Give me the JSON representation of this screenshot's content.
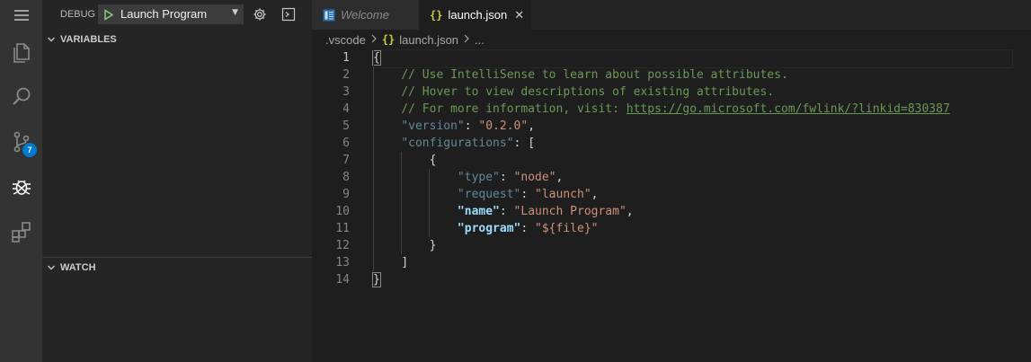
{
  "activity": {
    "badge_count": "7"
  },
  "sidebar": {
    "debug_label": "DEBUG",
    "config_name": "Launch Program",
    "variables_title": "VARIABLES",
    "watch_title": "WATCH"
  },
  "tabs": [
    {
      "label": "Welcome"
    },
    {
      "label": "launch.json",
      "close": "✕"
    }
  ],
  "breadcrumb": {
    "folder": ".vscode",
    "file": "launch.json",
    "more": "..."
  },
  "editor": {
    "line_numbers": [
      "1",
      "2",
      "3",
      "4",
      "5",
      "6",
      "7",
      "8",
      "9",
      "10",
      "11",
      "12",
      "13",
      "14"
    ],
    "lines": {
      "l1": "{",
      "l2": "// Use IntelliSense to learn about possible attributes.",
      "l3": "// Hover to view descriptions of existing attributes.",
      "l4_prefix": "// For more information, visit: ",
      "l4_link": "https://go.microsoft.com/fwlink/?linkid=830387",
      "l5_key": "\"version\"",
      "l5_val": "\"0.2.0\"",
      "l6_key": "\"configurations\"",
      "l7": "{",
      "l8_key": "\"type\"",
      "l8_val": "\"node\"",
      "l9_key": "\"request\"",
      "l9_val": "\"launch\"",
      "l10_key": "\"name\"",
      "l10_val": "\"Launch Program\"",
      "l11_key": "\"program\"",
      "l11_val": "\"${file}\"",
      "l12": "}",
      "l13": "]",
      "l14": "}"
    }
  },
  "colors": {
    "activity_bar": "#333333",
    "sidebar": "#252526",
    "editor": "#1e1e1e",
    "accent": "#007acc",
    "comment": "#6a9955",
    "key": "#9cdcfe",
    "string": "#ce9178"
  },
  "icons": [
    "menu-icon",
    "files-icon",
    "search-icon",
    "source-control-icon",
    "debug-icon",
    "extensions-icon",
    "play-icon",
    "gear-icon",
    "terminal-icon",
    "json-file-icon",
    "welcome-file-icon"
  ]
}
